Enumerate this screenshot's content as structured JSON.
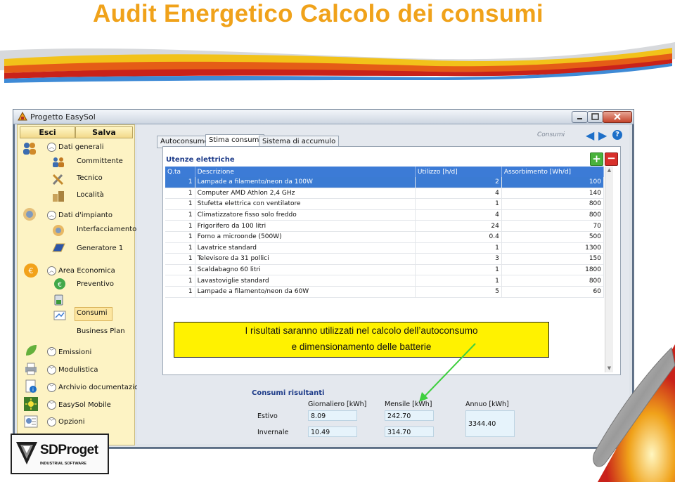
{
  "slide": {
    "title": "Audit Energetico Calcolo dei consumi"
  },
  "window": {
    "title": "Progetto EasySol"
  },
  "left_panel": {
    "esci_label": "Esci",
    "salva_label": "Salva",
    "sections": [
      {
        "label": "Dati generali",
        "items": [
          "Committente",
          "Tecnico",
          "Località"
        ]
      },
      {
        "label": "Dati d'impianto",
        "items": [
          "Interfacciamento",
          "Generatore 1"
        ]
      },
      {
        "label": "Area Economica",
        "items": [
          "Preventivo",
          "Consumi",
          "Business Plan"
        ]
      },
      {
        "label": "Emissioni",
        "items": []
      },
      {
        "label": "Modulistica",
        "items": []
      },
      {
        "label": "Archivio documentazio",
        "items": []
      },
      {
        "label": "EasySol Mobile",
        "items": []
      },
      {
        "label": "Opzioni",
        "items": []
      }
    ]
  },
  "tabs": [
    "Autoconsumo",
    "Stima consumi",
    "Sistema di accumulo"
  ],
  "header": {
    "section": "Consumi"
  },
  "table": {
    "title": "Utenze elettriche",
    "columns": [
      "Q.ta",
      "Descrizione",
      "Utilizzo [h/d]",
      "Assorbimento [Wh/d]"
    ],
    "rows": [
      [
        "1",
        "Lampade a filamento/neon da 100W",
        "2",
        "100"
      ],
      [
        "1",
        "Computer AMD Athlon 2,4 GHz",
        "4",
        "140"
      ],
      [
        "1",
        "Stufetta elettrica con ventilatore",
        "1",
        "800"
      ],
      [
        "1",
        "Climatizzatore fisso solo freddo",
        "4",
        "800"
      ],
      [
        "1",
        "Frigorifero da 100 litri",
        "24",
        "70"
      ],
      [
        "1",
        "Forno a microonde (500W)",
        "0.4",
        "500"
      ],
      [
        "1",
        "Lavatrice standard",
        "1",
        "1300"
      ],
      [
        "1",
        "Televisore da 31 pollici",
        "3",
        "150"
      ],
      [
        "1",
        "Scaldabagno 60 litri",
        "1",
        "1800"
      ],
      [
        "1",
        "Lavastoviglie standard",
        "1",
        "800"
      ],
      [
        "1",
        "Lampade a filamento/neon da 60W",
        "5",
        "60"
      ]
    ]
  },
  "callout": {
    "line1": "I risultati saranno utilizzati nel calcolo dell’autoconsumo",
    "line2": "e dimensionamento delle batterie"
  },
  "results": {
    "title": "Consumi risultanti",
    "col_giornaliero": "Giornaliero [kWh]",
    "col_mensile": "Mensile [kWh]",
    "col_annuo": "Annuo [kWh]",
    "estivo_label": "Estivo",
    "invernale_label": "Invernale",
    "estivo_giornaliero": "8.09",
    "estivo_mensile": "242.70",
    "invernale_giornaliero": "10.49",
    "invernale_mensile": "314.70",
    "annuo": "3344.40"
  },
  "logo": {
    "name": "SDProget",
    "tagline": "INDUSTRIAL SOFTWARE"
  },
  "colors": {
    "title": "#f0a21a",
    "table_header": "#3c7bd6",
    "callout": "#fff200",
    "arrow": "#3fcf3f"
  }
}
